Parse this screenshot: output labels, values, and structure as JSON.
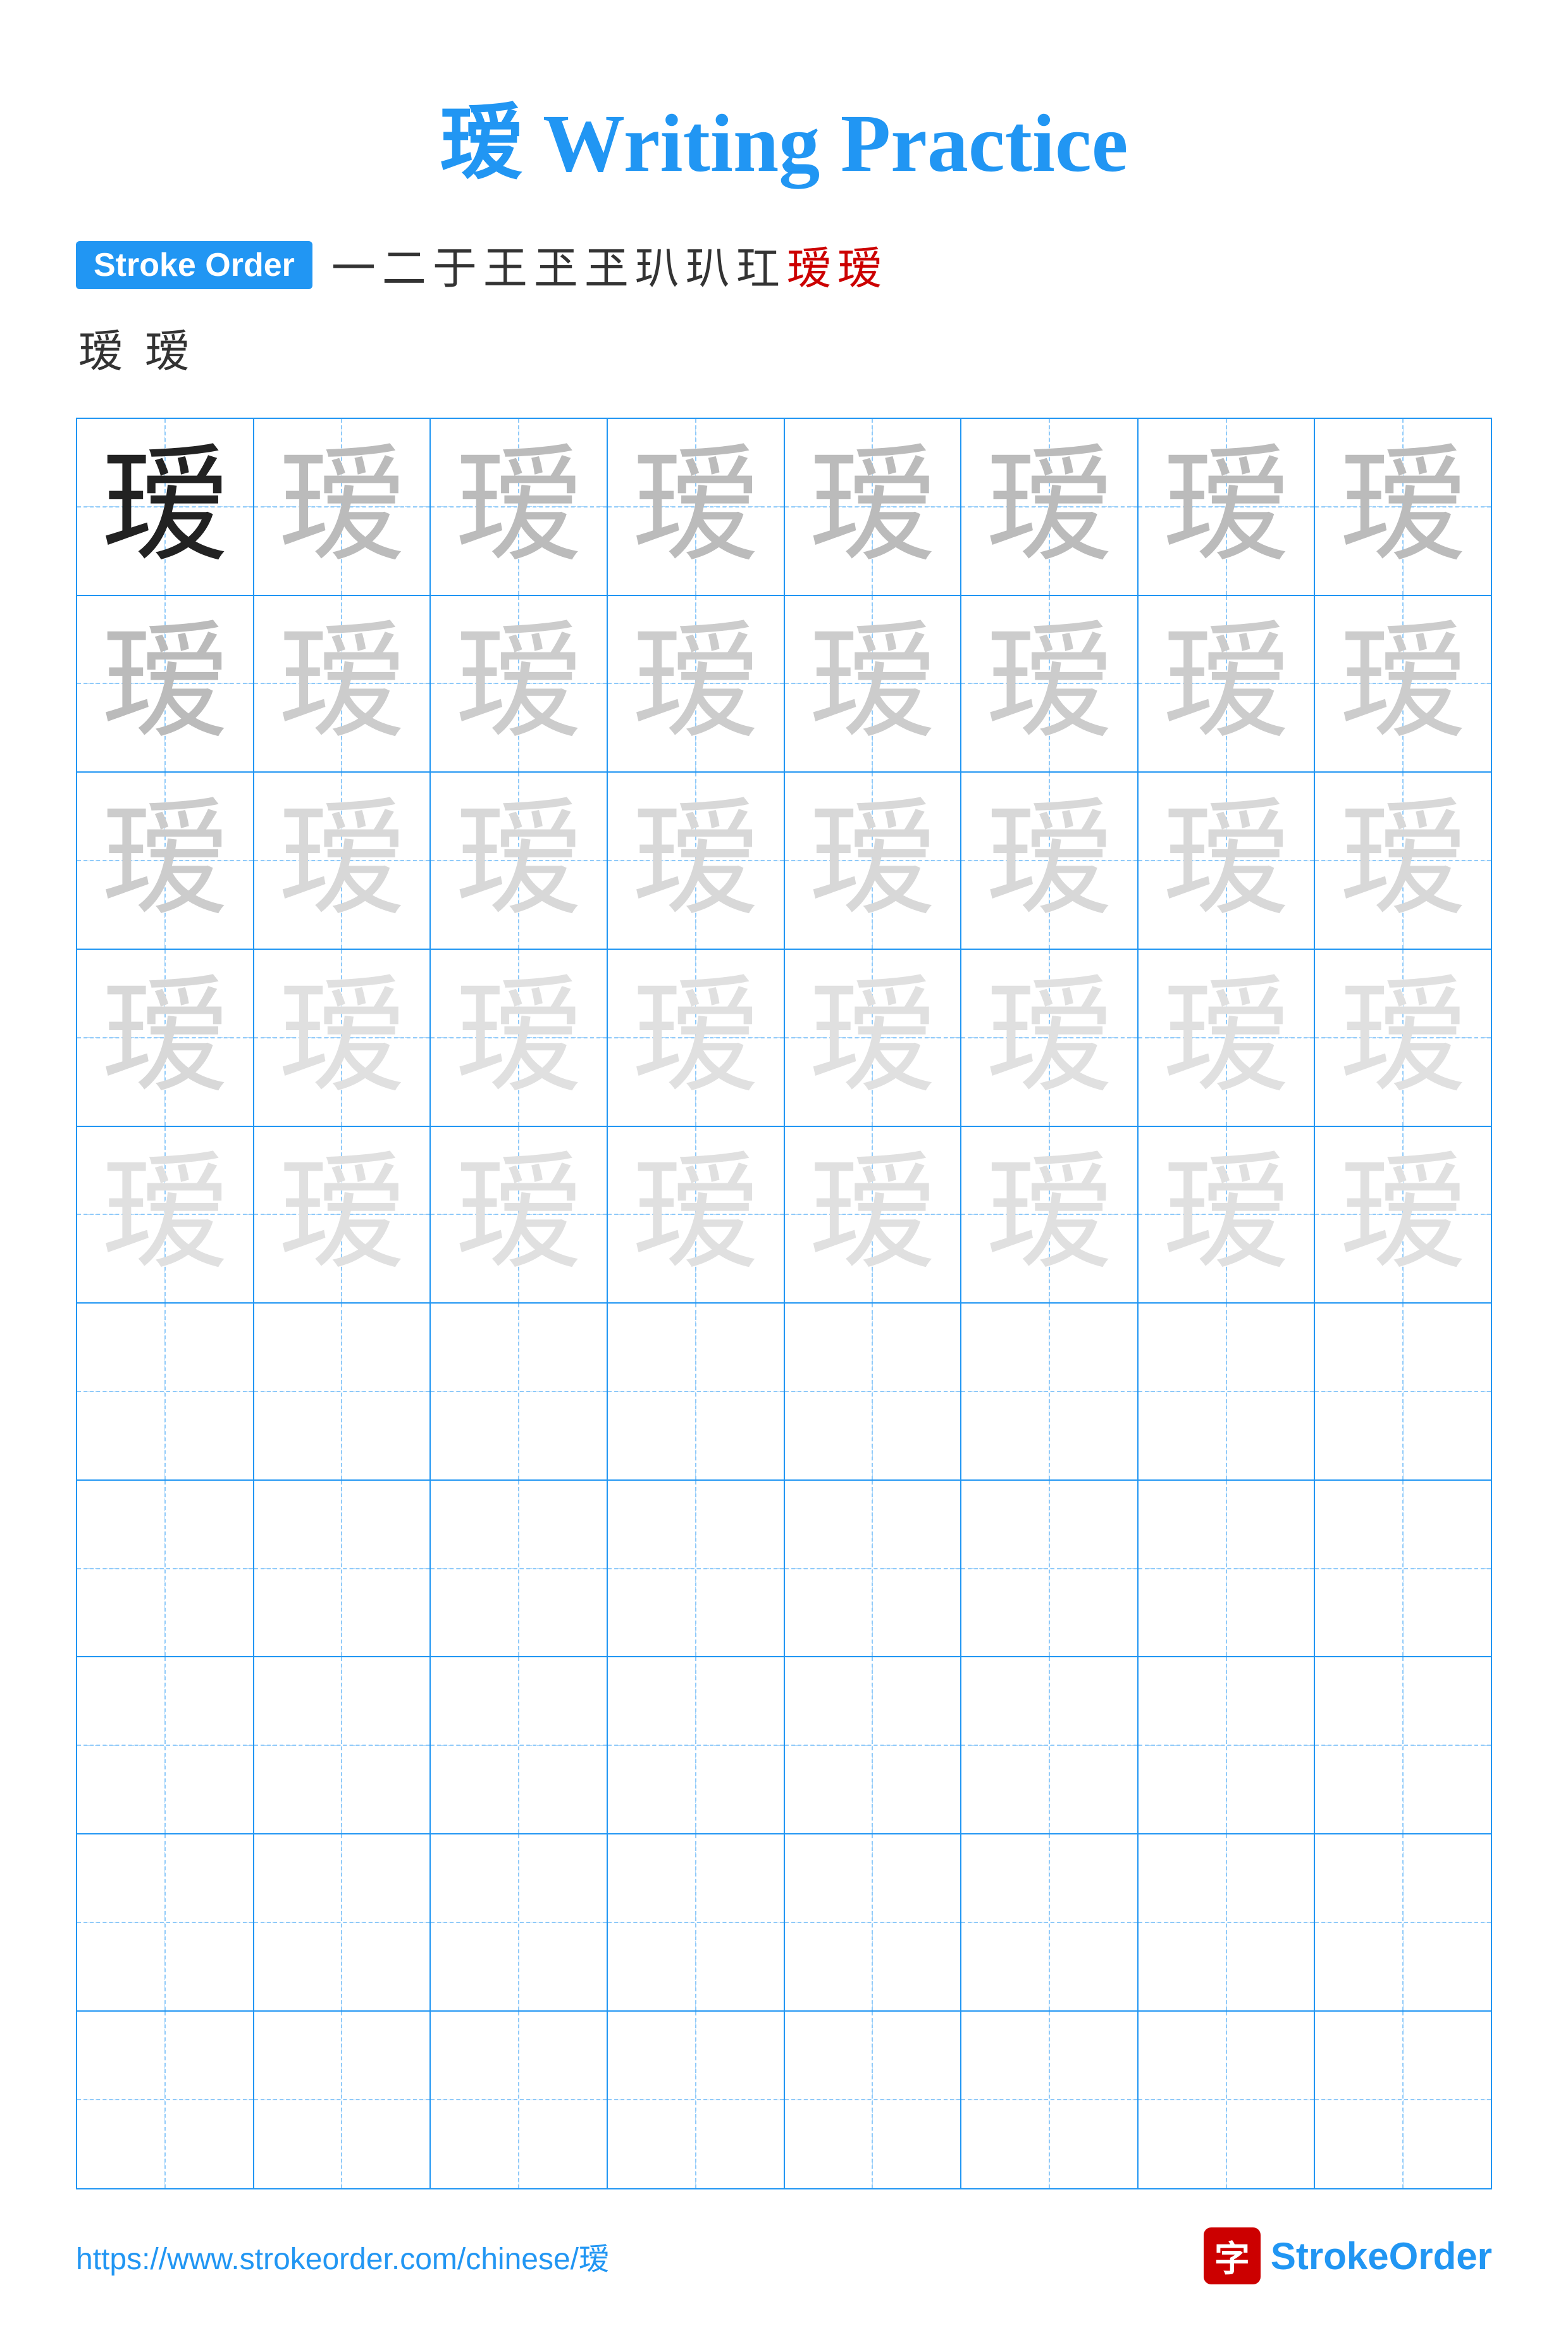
{
  "title": {
    "char": "瑷",
    "suffix": " Writing Practice"
  },
  "stroke_order": {
    "badge": "Stroke Order",
    "strokes_row1": [
      "一",
      "二",
      "于",
      "王",
      "玊",
      "玊",
      "玐",
      "玐",
      "玒",
      "瑷",
      "瑷"
    ],
    "strokes_row2": [
      "瑷",
      "瑷"
    ]
  },
  "grid": {
    "char": "瑷",
    "rows": 10,
    "cols": 8,
    "filled_rows": 5,
    "opacities": [
      "dark",
      "light1",
      "light2",
      "light3",
      "light4"
    ]
  },
  "footer": {
    "url": "https://www.strokeorder.com/chinese/瑷",
    "logo_char": "字",
    "logo_name": "StrokeOrder",
    "logo_name_colored": "Stroke",
    "logo_name_plain": "Order"
  }
}
